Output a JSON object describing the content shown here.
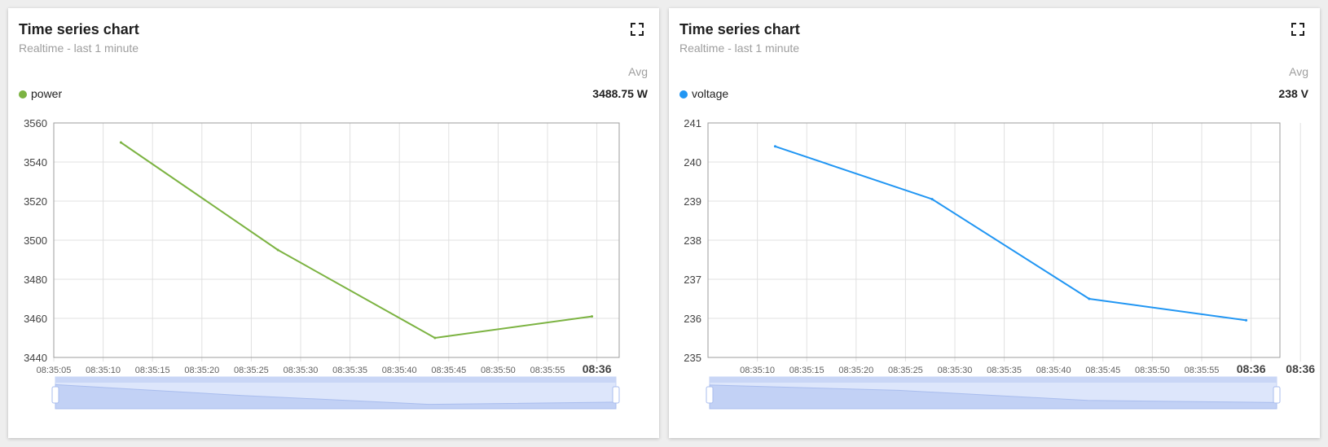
{
  "widgets": [
    {
      "title": "Time series chart",
      "subtitle": "Realtime - last 1 minute",
      "avg_header": "Avg",
      "legend": {
        "label": "power",
        "value": "3488.75 W",
        "color": "#7cb342"
      },
      "fullscreen_icon": "fullscreen-icon",
      "chart_data": {
        "type": "line",
        "title": "",
        "xlabel": "",
        "ylabel": "",
        "ylim": [
          3440,
          3560
        ],
        "y_ticks": [
          "3560",
          "3540",
          "3520",
          "3500",
          "3480",
          "3460",
          "3440"
        ],
        "x_ticks": [
          "08:35:05",
          "08:35:10",
          "08:35:15",
          "08:35:20",
          "08:35:25",
          "08:35:30",
          "08:35:35",
          "08:35:40",
          "08:35:45",
          "08:35:50",
          "08:35:55",
          "08:36"
        ],
        "grid": true,
        "series": [
          {
            "name": "power",
            "color": "#7cb342",
            "x": [
              "08:35:11.8",
              "08:35:27.7",
              "08:35:43.6",
              "08:35:59.5"
            ],
            "values": [
              3550,
              3495,
              3450,
              3461
            ]
          }
        ]
      }
    },
    {
      "title": "Time series chart",
      "subtitle": "Realtime - last 1 minute",
      "avg_header": "Avg",
      "legend": {
        "label": "voltage",
        "value": "238 V",
        "color": "#2196f3"
      },
      "fullscreen_icon": "fullscreen-icon",
      "chart_data": {
        "type": "line",
        "title": "",
        "xlabel": "",
        "ylabel": "",
        "ylim": [
          235,
          241
        ],
        "y_ticks": [
          "241",
          "240",
          "239",
          "238",
          "237",
          "236",
          "235"
        ],
        "x_ticks": [
          "08:35:10",
          "08:35:15",
          "08:35:20",
          "08:35:25",
          "08:35:30",
          "08:35:35",
          "08:35:40",
          "08:35:45",
          "08:35:50",
          "08:35:55",
          "08:36",
          "08:36"
        ],
        "grid": true,
        "series": [
          {
            "name": "voltage",
            "color": "#2196f3",
            "x": [
              "08:35:11.8",
              "08:35:27.7",
              "08:35:43.6",
              "08:35:59.5"
            ],
            "values": [
              240.4,
              239.05,
              236.5,
              235.95
            ]
          }
        ]
      }
    }
  ]
}
